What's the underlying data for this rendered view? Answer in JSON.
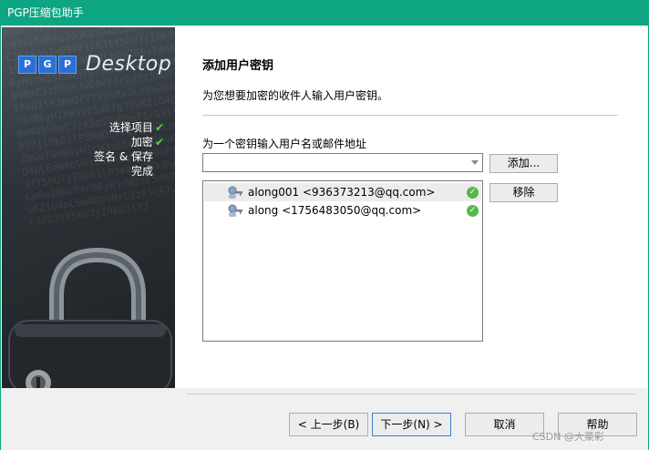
{
  "window": {
    "title": "PGP压缩包助手"
  },
  "sidebar": {
    "logo_letters": [
      "P",
      "G",
      "P"
    ],
    "logo_word": "Desktop",
    "steps": [
      {
        "label": "选择项目",
        "done": true
      },
      {
        "label": "加密",
        "done": true
      },
      {
        "label": "签名 & 保存",
        "done": false
      },
      {
        "label": "完成",
        "done": false
      }
    ]
  },
  "main": {
    "title": "添加用户密钥",
    "subtitle": "为您想要加密的收件人输入用户密钥。",
    "field_label": "为一个密钥输入用户名或邮件地址",
    "combo_value": "",
    "add_button": "添加...",
    "remove_button": "移除",
    "recipients": [
      {
        "text": "along001 <936373213@qq.com>",
        "selected": true,
        "status": "valid"
      },
      {
        "text": "along <1756483050@qq.com>",
        "selected": false,
        "status": "valid"
      }
    ]
  },
  "footer": {
    "back_button": "< 上一步(B)",
    "next_button": "下一步(N) >",
    "cancel_button": "取消",
    "help_button": "帮助"
  },
  "watermark": "CSDN @大菜彩",
  "colors": {
    "titlebar": "#0ea582",
    "check": "#52d83a",
    "valid": "#57b84a"
  }
}
